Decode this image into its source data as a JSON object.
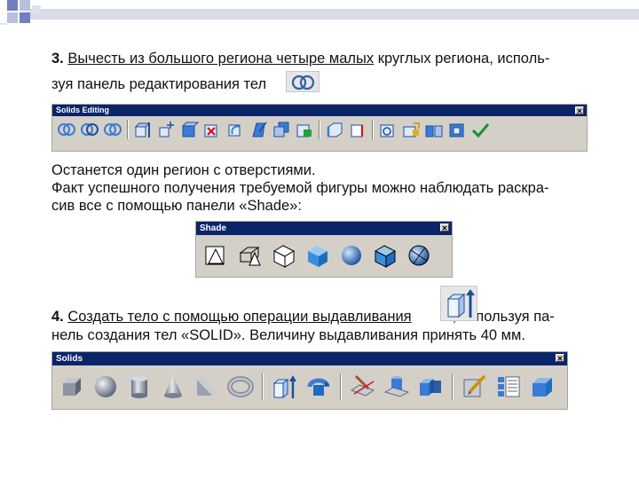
{
  "para1": {
    "number": "3.",
    "underlined": "Вычесть из большого региона четыре малых",
    "rest_line1": " круглых региона, исполь-",
    "line2_before_icon": "зуя панель редактирования тел",
    "line2_after_icon": ".",
    "icon": "union-rings-icon"
  },
  "toolbar_solids_editing": {
    "title": "Solids Editing",
    "close": "✕"
  },
  "para2": {
    "line1": "Останется один регион с отверстиями.",
    "line2": "Факт успешного получения требуемой фигуры можно наблюдать раскра-",
    "line3": "сив все с помощью панели «Shade»:"
  },
  "toolbar_shade": {
    "title": "Shade",
    "close": "✕"
  },
  "para3": {
    "number": "4.",
    "underlined": "Создать тело с помощью операции выдавливания",
    "after_icon": ", используя па-",
    "line2": "нель создания тел «SOLID». Величину выдавливания принять 40 мм.",
    "icon": "extrude-icon"
  },
  "toolbar_solids": {
    "title": "Solids",
    "close": "✕"
  },
  "colors": {
    "accent": "#6f7fbf",
    "titlebar": "#0a246a",
    "toolbar_bg": "#d4d0c8",
    "icon_blue": "#3a7bd5"
  }
}
